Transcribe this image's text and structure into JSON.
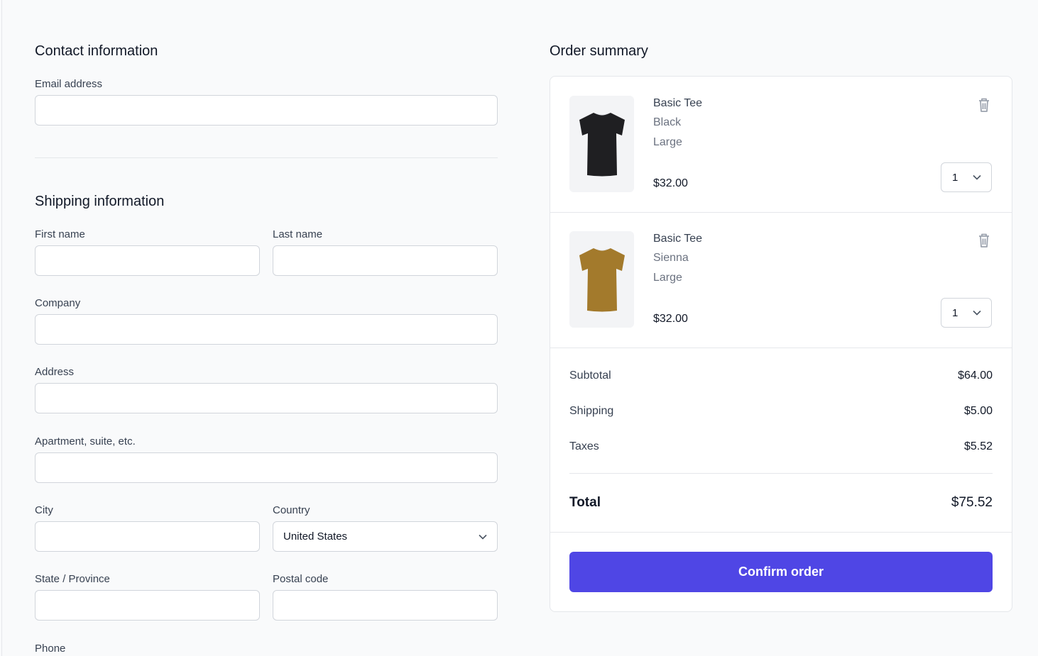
{
  "contact": {
    "title": "Contact information",
    "email_label": "Email address",
    "email_value": ""
  },
  "shipping": {
    "title": "Shipping information",
    "first_name_label": "First name",
    "last_name_label": "Last name",
    "company_label": "Company",
    "address_label": "Address",
    "apartment_label": "Apartment, suite, etc.",
    "city_label": "City",
    "country_label": "Country",
    "country_value": "United States",
    "state_label": "State / Province",
    "postal_label": "Postal code",
    "phone_label": "Phone"
  },
  "order": {
    "title": "Order summary",
    "items": [
      {
        "name": "Basic Tee",
        "color": "Black",
        "size": "Large",
        "price": "$32.00",
        "qty": "1",
        "shirt_color": "#1f1f22"
      },
      {
        "name": "Basic Tee",
        "color": "Sienna",
        "size": "Large",
        "price": "$32.00",
        "qty": "1",
        "shirt_color": "#a37a2c"
      }
    ],
    "subtotal_label": "Subtotal",
    "subtotal_value": "$64.00",
    "shipping_label": "Shipping",
    "shipping_value": "$5.00",
    "taxes_label": "Taxes",
    "taxes_value": "$5.52",
    "total_label": "Total",
    "total_value": "$75.52",
    "confirm_label": "Confirm order"
  },
  "colors": {
    "accent": "#4f46e5",
    "border": "#d1d5db",
    "background": "#f9fafb"
  }
}
